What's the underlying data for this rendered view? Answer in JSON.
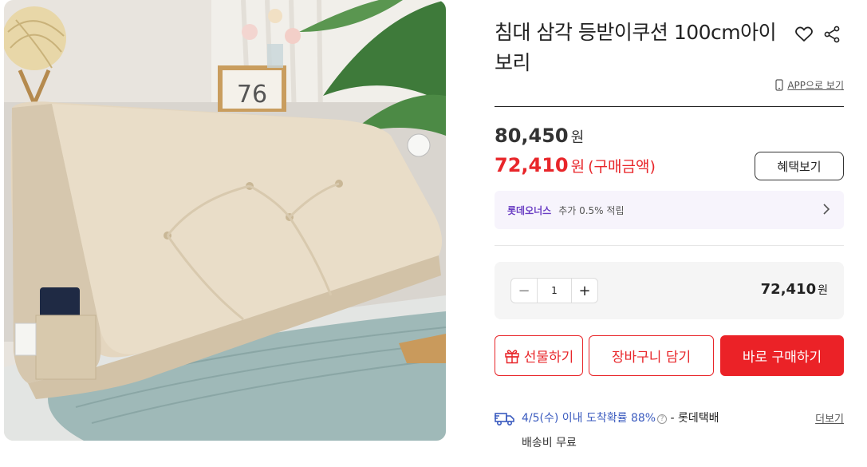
{
  "product": {
    "title": "침대 삼각 등받이쿠션 100cm아이보리",
    "image_alt": "beige triangular bed backrest cushion",
    "calendar_number": "76"
  },
  "header_icons": {
    "wishlist": "heart-icon",
    "share": "share-icon"
  },
  "app_link": {
    "label": "APP으로 보기",
    "icon": "mobile-icon"
  },
  "price": {
    "original": "80,450",
    "original_unit": "원",
    "sale": "72,410",
    "sale_unit": "원",
    "sale_note": "(구매금액)",
    "benefit_button": "혜택보기"
  },
  "membership": {
    "brand": "롯데오너스",
    "description": "추가 0.5% 적립",
    "icon": "chevron-right-icon"
  },
  "quantity": {
    "value": "1",
    "minus": "−",
    "plus": "+",
    "total": "72,410",
    "total_unit": "원"
  },
  "actions": {
    "gift": "선물하기",
    "cart": "장바구니 담기",
    "buy": "바로 구매하기"
  },
  "delivery": {
    "estimate": "4/5(수) 이내 도착확률 88%",
    "help": "?",
    "carrier": " - 롯데택배",
    "more": "더보기",
    "fee": "배송비 무료"
  },
  "colors": {
    "accent": "#e8262a",
    "delivery_blue": "#3b5bbf",
    "membership_purple": "#6b3fc4"
  }
}
